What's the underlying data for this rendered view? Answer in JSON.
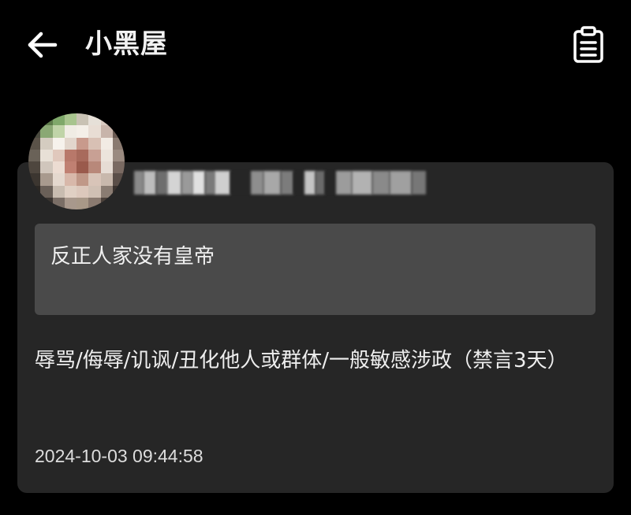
{
  "header": {
    "back_icon": "arrow-left-icon",
    "title": "小黑屋",
    "action_icon": "clipboard-list-icon"
  },
  "record": {
    "avatar": "blurred-user-avatar",
    "username": "",
    "comment": "反正人家没有皇帝",
    "reason": "辱骂/侮辱/讥讽/丑化他人或群体/一般敏感涉政（禁言3天）",
    "timestamp": "2024-10-03 09:44:58"
  },
  "colors": {
    "background": "#000000",
    "card": "#262626",
    "comment_box": "#4a4a4a",
    "text": "#ffffff"
  }
}
